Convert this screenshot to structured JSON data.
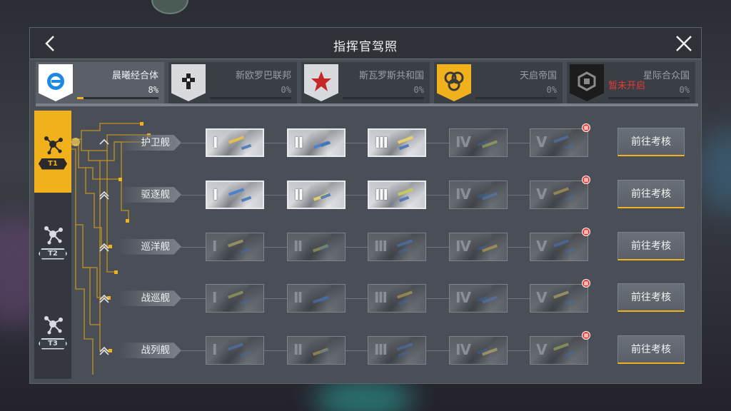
{
  "header": {
    "title": "指挥官驾照"
  },
  "factions": [
    {
      "name": "晨曦经合体",
      "percent": "8%",
      "progress": 0.08,
      "active": true,
      "color": "#ffffff",
      "accent": "#1e88e5",
      "icon": "circle-logo-icon"
    },
    {
      "name": "新欧罗巴联邦",
      "percent": "0%",
      "progress": 0,
      "active": false,
      "color": "#d8dade",
      "accent": "#222222",
      "icon": "cross-logo-icon"
    },
    {
      "name": "斯瓦罗斯共和国",
      "percent": "0%",
      "progress": 0,
      "active": false,
      "color": "#d8dade",
      "accent": "#c62828",
      "icon": "star-logo-icon"
    },
    {
      "name": "天启帝国",
      "percent": "0%",
      "progress": 0,
      "active": false,
      "color": "#f0b11c",
      "accent": "#3a3a3a",
      "icon": "rings-logo-icon"
    },
    {
      "name": "星际合众国",
      "percent": "0%",
      "progress": 0,
      "active": false,
      "color": "#1c1c1c",
      "accent": "#8a8a8a",
      "icon": "cube-logo-icon",
      "locked_text": "暂未开启"
    }
  ],
  "tiers": [
    {
      "label": "T1",
      "active": true,
      "icon": "molecule-icon"
    },
    {
      "label": "T2",
      "active": false,
      "icon": "molecule-icon"
    },
    {
      "label": "T3",
      "active": false,
      "icon": "molecule-icon"
    }
  ],
  "rows": [
    {
      "class_name": "护卫舰",
      "unlocked": 3,
      "button": "前往考核"
    },
    {
      "class_name": "驱逐舰",
      "unlocked": 3,
      "button": "前往考核"
    },
    {
      "class_name": "巡洋舰",
      "unlocked": 0,
      "button": "前往考核"
    },
    {
      "class_name": "战巡舰",
      "unlocked": 0,
      "button": "前往考核"
    },
    {
      "class_name": "战列舰",
      "unlocked": 0,
      "button": "前往考核"
    }
  ],
  "levels": [
    "Ⅰ",
    "Ⅱ",
    "Ⅲ",
    "Ⅳ",
    "Ⅴ"
  ],
  "colors": {
    "accent": "#f0b11c",
    "locked_red": "#e53935"
  }
}
